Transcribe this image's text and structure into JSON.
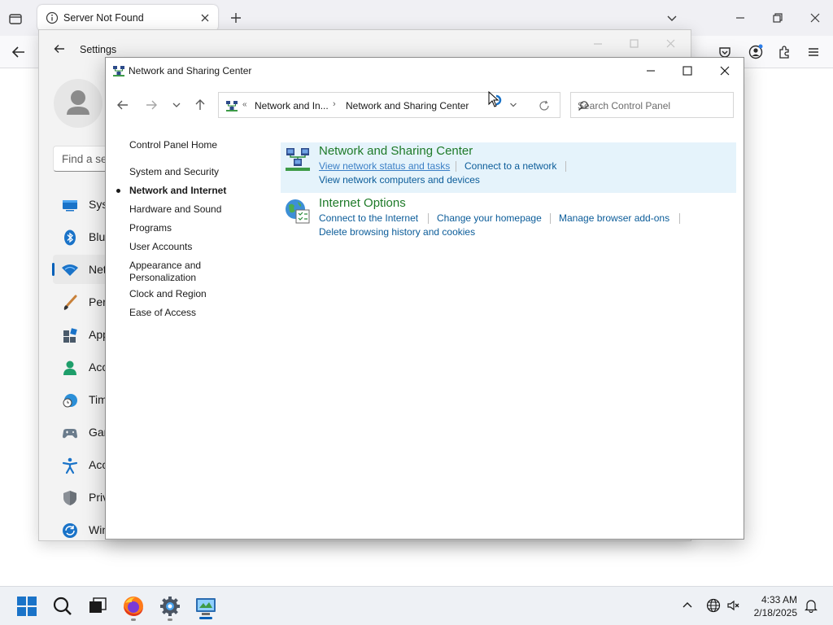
{
  "browser": {
    "tab_title": "Server Not Found"
  },
  "settings": {
    "title": "Settings",
    "search_placeholder": "Find a se",
    "nav": [
      {
        "label": "Syst",
        "icon": "system-icon"
      },
      {
        "label": "Blue",
        "icon": "bluetooth-icon"
      },
      {
        "label": "Net",
        "icon": "wifi-icon"
      },
      {
        "label": "Pers",
        "icon": "brush-icon"
      },
      {
        "label": "App",
        "icon": "apps-icon"
      },
      {
        "label": "Acc",
        "icon": "person-icon"
      },
      {
        "label": "Tim",
        "icon": "clock-globe-icon"
      },
      {
        "label": "Gan",
        "icon": "gamepad-icon"
      },
      {
        "label": "Acc",
        "icon": "accessibility-icon"
      },
      {
        "label": "Priv",
        "icon": "shield-icon"
      },
      {
        "label": "Win",
        "icon": "update-icon"
      }
    ]
  },
  "control_panel": {
    "title": "Network and Sharing Center",
    "address": {
      "chevron": "«",
      "segment1": "Network and In...",
      "separator": "›",
      "segment2": "Network and Sharing Center"
    },
    "search_placeholder": "Search Control Panel",
    "sidebar": {
      "home": "Control Panel Home",
      "items": [
        "System and Security",
        "Network and Internet",
        "Hardware and Sound",
        "Programs",
        "User Accounts",
        "Appearance and",
        "Personalization",
        "Clock and Region",
        "Ease of Access"
      ]
    },
    "categories": [
      {
        "title": "Network and Sharing Center",
        "links": [
          "View network status and tasks",
          "Connect to a network",
          "View network computers and devices"
        ]
      },
      {
        "title": "Internet Options",
        "links": [
          "Connect to the Internet",
          "Change your homepage",
          "Manage browser add-ons",
          "Delete browsing history and cookies"
        ]
      }
    ]
  },
  "taskbar": {
    "time": "4:33 AM",
    "date": "2/18/2025"
  },
  "colors": {
    "accent": "#005fb8",
    "category_title": "#1e7a28",
    "link": "#0b5c99",
    "highlight": "#e5f3fb"
  }
}
